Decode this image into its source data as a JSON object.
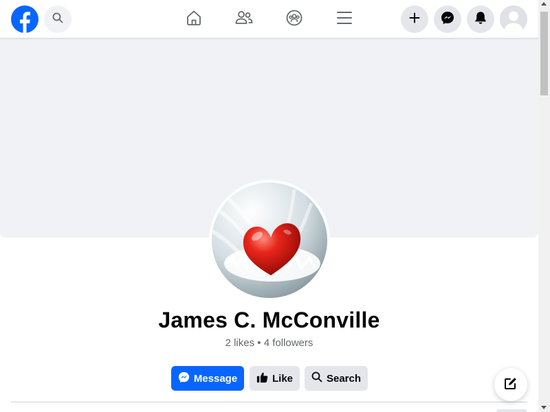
{
  "app": {
    "brand_color": "#0866ff",
    "icons": {
      "logo": "facebook-logo",
      "search": "search-icon",
      "home": "home-icon",
      "friends": "friends-icon",
      "groups": "groups-icon",
      "menu": "menu-icon",
      "create": "plus-icon",
      "messenger": "messenger-icon",
      "notifications": "bell-icon",
      "account": "avatar-icon",
      "compose": "compose-icon"
    }
  },
  "profile": {
    "name": "James C. McConville",
    "stats": "2 likes • 4 followers"
  },
  "actions": {
    "message_label": "Message",
    "like_label": "Like",
    "search_label": "Search"
  }
}
